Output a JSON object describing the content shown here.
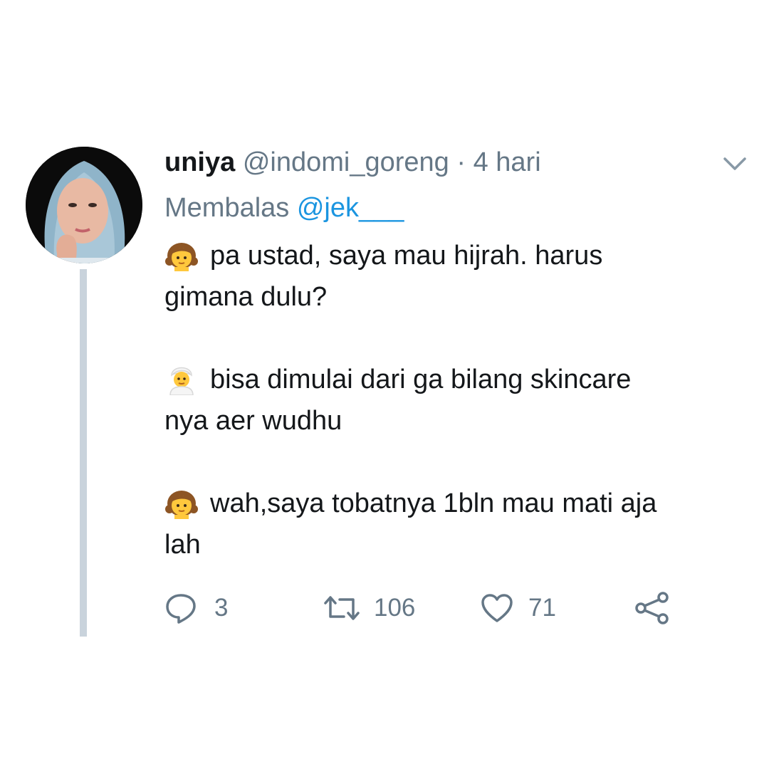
{
  "tweet": {
    "display_name": "uniya",
    "handle": "@indomi_goreng",
    "separator": "·",
    "time": "4 hari",
    "reply_prefix": "Membalas",
    "reply_to": "@jek___",
    "lines": [
      {
        "emoji": "girl-emoji",
        "text": "pa ustad, saya mau hijrah. harus"
      },
      {
        "text": "gimana dulu?"
      },
      {
        "text": ""
      },
      {
        "emoji": "man-with-turban-emoji",
        "text": "bisa dimulai dari ga bilang skincare"
      },
      {
        "text": "nya aer wudhu"
      },
      {
        "text": ""
      },
      {
        "emoji": "girl-emoji",
        "text": "wah,saya tobatnya 1bln mau mati aja"
      },
      {
        "text": "lah"
      }
    ]
  },
  "actions": {
    "reply_count": "3",
    "retweet_count": "106",
    "like_count": "71"
  },
  "colors": {
    "text": "#14171a",
    "secondary": "#657786",
    "link": "#1b95e0",
    "thread_line": "#c9d3dc"
  },
  "icons": [
    "chevron-down-icon",
    "reply-icon",
    "retweet-icon",
    "heart-icon",
    "share-icon"
  ]
}
